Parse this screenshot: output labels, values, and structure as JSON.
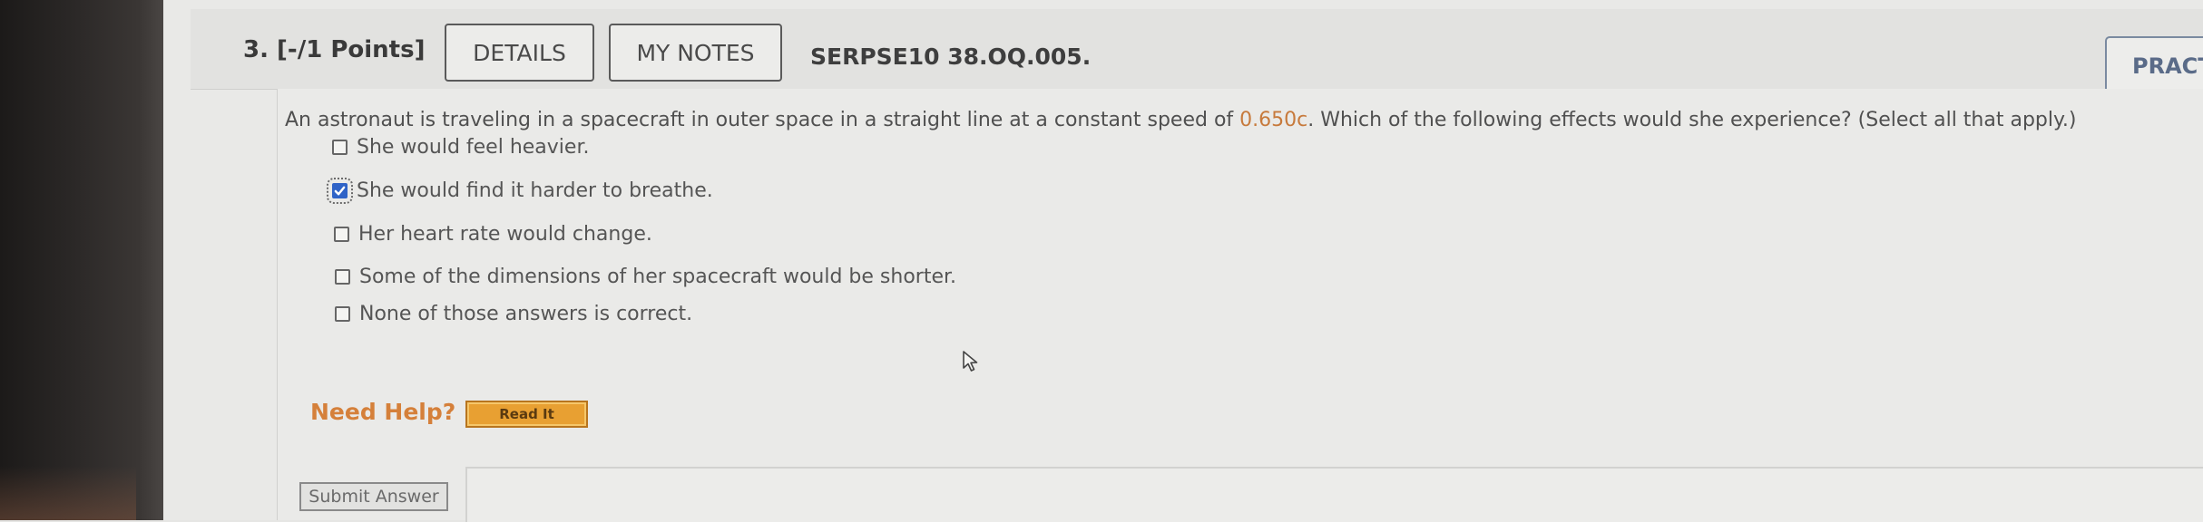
{
  "question": {
    "number_label": "3. [-/1 Points]",
    "details_label": "DETAILS",
    "notes_label": "MY NOTES",
    "source_id": "SERPSE10 38.OQ.005.",
    "practice_label": "PRACTIC",
    "prompt_before": "An astronaut is traveling in a spacecraft in outer space in a straight line at a constant speed of ",
    "prompt_speed": "0.650c",
    "prompt_after": ". Which of the following effects would she experience? (Select all that apply.)",
    "options": [
      {
        "label": "She would feel heavier.",
        "checked": false
      },
      {
        "label": "She would find it harder to breathe.",
        "checked": true
      },
      {
        "label": "Her heart rate would change.",
        "checked": false
      },
      {
        "label": "Some of the dimensions of her spacecraft would be shorter.",
        "checked": false
      },
      {
        "label": "None of those answers is correct.",
        "checked": false
      }
    ]
  },
  "help": {
    "need_help_label": "Need Help?",
    "read_it_label": "Read It"
  },
  "submit": {
    "label": "Submit Answer"
  },
  "colors": {
    "accent_orange": "#d5803a",
    "checkbox_blue": "#2f63c7",
    "speed_value": "#c77a3c"
  },
  "icons": {
    "checkmark": "checkmark-icon",
    "cursor": "mouse-pointer-icon"
  }
}
